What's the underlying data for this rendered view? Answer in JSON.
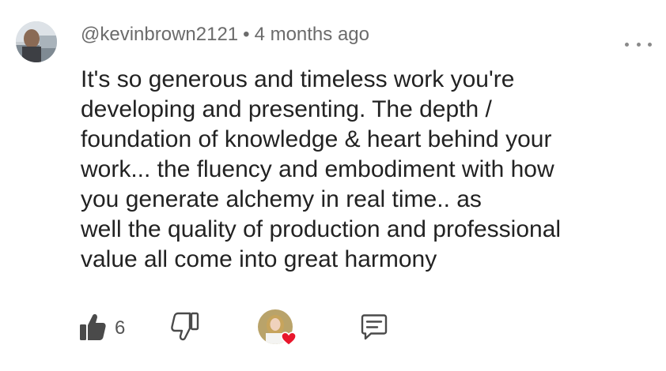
{
  "comment": {
    "author": "@kevinbrown2121",
    "separator": "•",
    "timestamp": "4 months ago",
    "text_lines": [
      "It's so generous and timeless work you're",
      "developing and presenting. The depth /",
      "foundation of knowledge & heart behind your",
      "work... the fluency and embodiment with how",
      "you generate alchemy in real time.. as",
      "well the quality of production and professional",
      "value all come into great harmony"
    ]
  },
  "actions": {
    "like_count": "6",
    "like_icon": "thumbs-up-icon",
    "dislike_icon": "thumbs-down-icon",
    "creator_heart_icon": "heart-icon",
    "reply_icon": "comment-reply-icon",
    "more_icon": "more-options-icon"
  },
  "colors": {
    "text": "#222222",
    "meta_text": "#6b6b6b",
    "icon": "#4a4a4a",
    "heart": "#e8172c"
  }
}
